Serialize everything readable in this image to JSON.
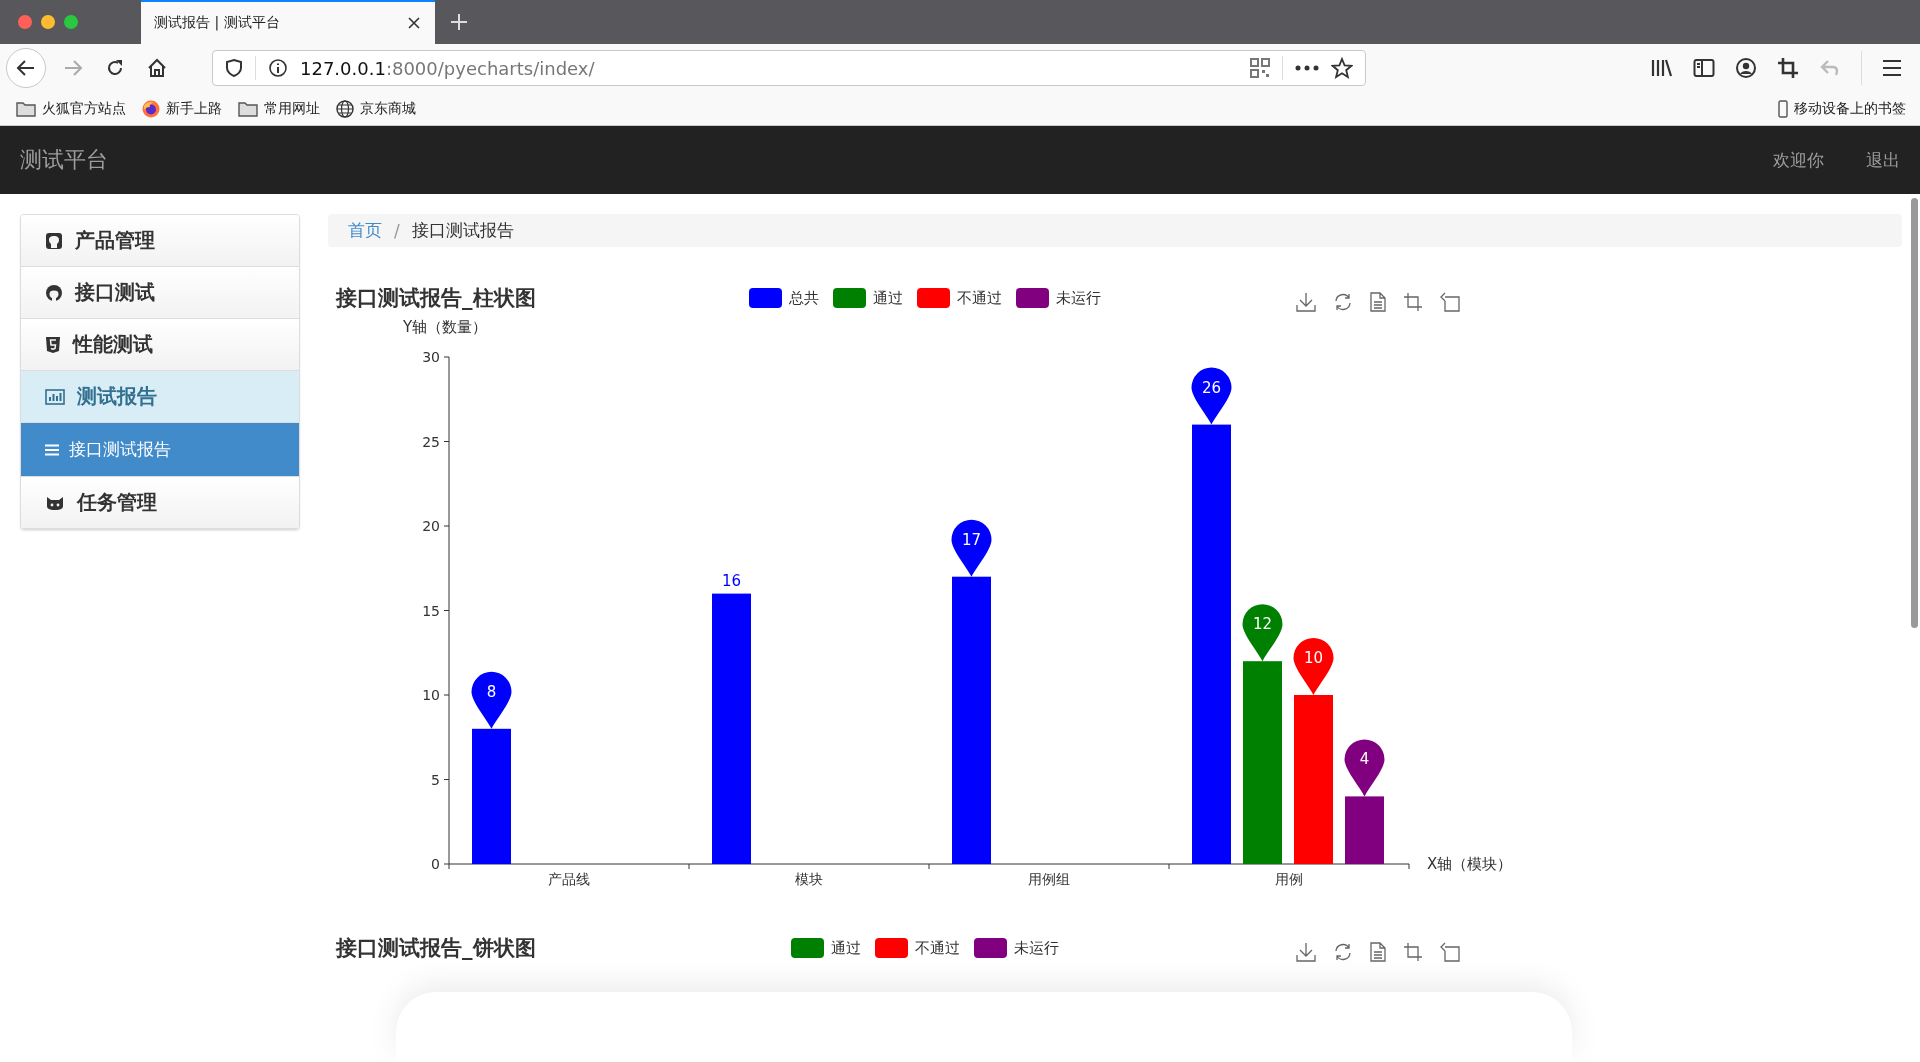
{
  "browser": {
    "tab": {
      "title": "测试报告 | 测试平台"
    },
    "url": {
      "host": "127.0.0.1",
      "path": ":8000/pyecharts/index/"
    },
    "bookmarks": [
      {
        "label": "火狐官方站点",
        "kind": "folder"
      },
      {
        "label": "新手上路",
        "kind": "firefox"
      },
      {
        "label": "常用网址",
        "kind": "folder"
      },
      {
        "label": "京东商城",
        "kind": "globe"
      }
    ],
    "mobile_bookmarks": "移动设备上的书签"
  },
  "navbar": {
    "brand": "测试平台",
    "links": [
      "欢迎你",
      "退出"
    ]
  },
  "sidebar": {
    "items": [
      {
        "label": "产品管理",
        "selected": false,
        "expanded": false
      },
      {
        "label": "接口测试",
        "selected": false,
        "expanded": false
      },
      {
        "label": "性能测试",
        "selected": false,
        "expanded": false
      },
      {
        "label": "测试报告",
        "selected": false,
        "expanded": true,
        "children": [
          {
            "label": "接口测试报告",
            "selected": true
          }
        ]
      },
      {
        "label": "任务管理",
        "selected": false,
        "expanded": false
      }
    ]
  },
  "breadcrumb": {
    "separator": "/",
    "items": [
      {
        "label": "首页",
        "kind": "link"
      },
      {
        "label": "接口测试报告",
        "kind": "current"
      }
    ]
  },
  "bar_chart": {
    "chart_data": {
      "type": "bar",
      "title": "接口测试报告_柱状图",
      "xlabel": "X轴（模块）",
      "ylabel": "Y轴（数量）",
      "categories": [
        "产品线",
        "模块",
        "用例组",
        "用例"
      ],
      "series": [
        {
          "name": "总共",
          "color": "#0000ff",
          "values": [
            8,
            16,
            17,
            26
          ]
        },
        {
          "name": "通过",
          "color": "#008000",
          "values": [
            null,
            null,
            null,
            12
          ]
        },
        {
          "name": "不通过",
          "color": "#ff0000",
          "values": [
            null,
            null,
            null,
            10
          ]
        },
        {
          "name": "未运行",
          "color": "#800080",
          "values": [
            null,
            null,
            null,
            4
          ]
        }
      ],
      "ylim": [
        0,
        30
      ],
      "yticks": [
        0,
        5,
        10,
        15,
        20,
        25,
        30
      ]
    },
    "bar_labels": [
      {
        "label": "8",
        "kind": "pin"
      },
      {
        "label": "16",
        "kind": "plain"
      },
      {
        "label": "17",
        "kind": "pin"
      },
      {
        "label": "26",
        "kind": "pin"
      },
      {
        "label": "12",
        "kind": "pin"
      },
      {
        "label": "10",
        "kind": "pin"
      },
      {
        "label": "4",
        "kind": "pin"
      }
    ]
  },
  "pie_chart": {
    "title": "接口测试报告_饼状图",
    "legend": [
      {
        "name": "通过",
        "color": "#008000"
      },
      {
        "name": "不通过",
        "color": "#ff0000"
      },
      {
        "name": "未运行",
        "color": "#800080"
      }
    ]
  }
}
